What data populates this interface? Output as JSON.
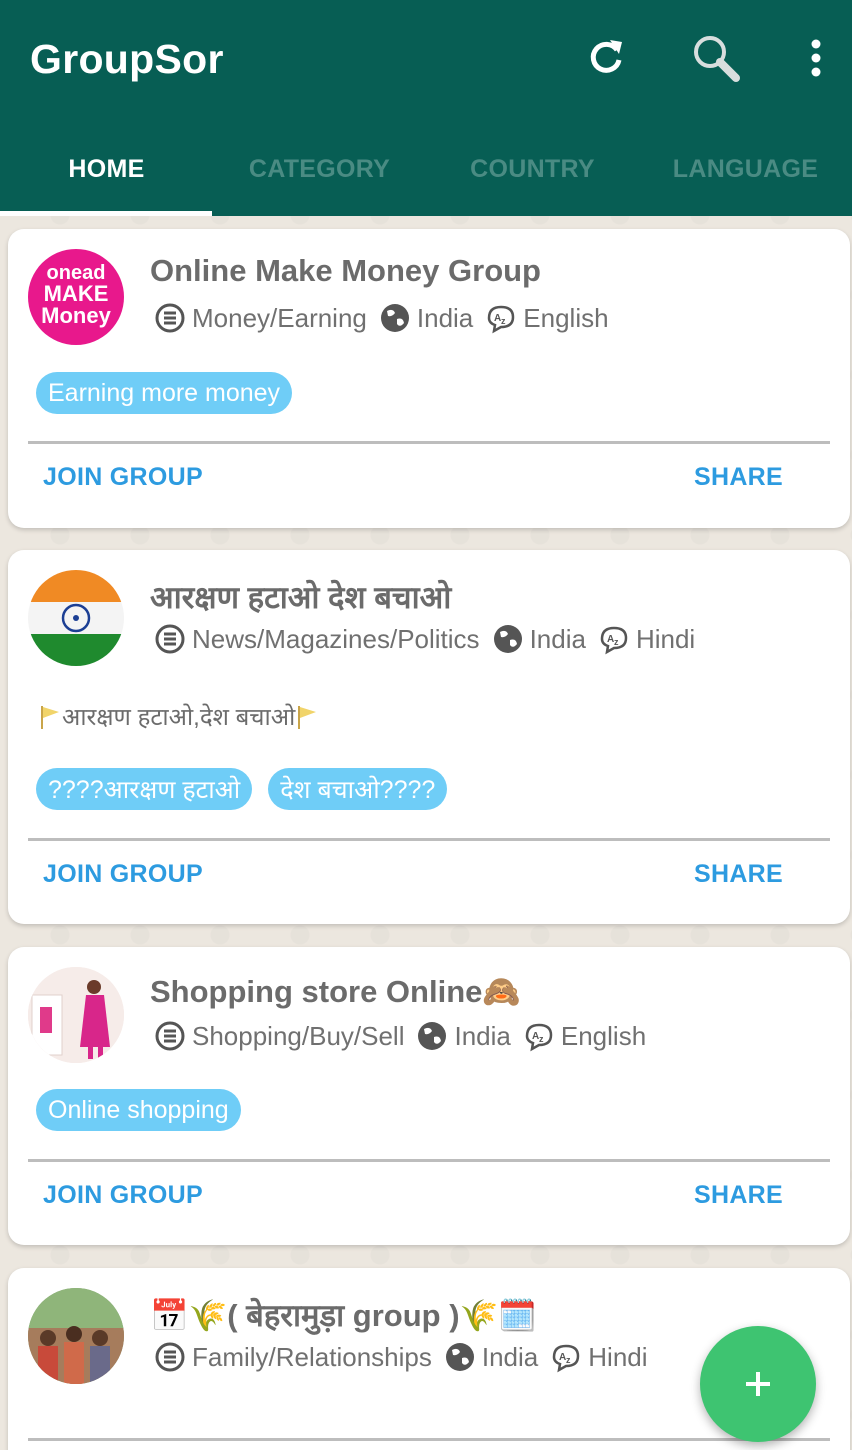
{
  "app": {
    "title": "GroupSor"
  },
  "toolbar": {
    "icons": [
      "refresh-icon",
      "search-icon",
      "more-vert-icon"
    ]
  },
  "tabs": [
    {
      "label": "HOME",
      "active": true
    },
    {
      "label": "CATEGORY",
      "active": false
    },
    {
      "label": "COUNTRY",
      "active": false
    },
    {
      "label": "LANGUAGE",
      "active": false
    }
  ],
  "colors": {
    "appbar": "#075e54",
    "chip": "#6fcdf7",
    "action": "#2d9be0",
    "fab": "#3ec471"
  },
  "cards": [
    {
      "title": "Online Make Money Group",
      "category": "Money/Earning",
      "country": "India",
      "language": "English",
      "description": "",
      "tags": [
        "Earning more money"
      ],
      "avatar_text": [
        "onead",
        "MAKE",
        "Money"
      ],
      "join_label": "JOIN GROUP",
      "share_label": "SHARE"
    },
    {
      "title": "आरक्षण हटाओ देश बचाओ",
      "category": "News/Magazines/Politics",
      "country": "India",
      "language": "Hindi",
      "description": "आरक्षण हटाओ,देश बचाओ",
      "tags": [
        "????आरक्षण हटाओ",
        "देश बचाओ????"
      ],
      "join_label": "JOIN GROUP",
      "share_label": "SHARE"
    },
    {
      "title": "Shopping store Online🙈",
      "category": "Shopping/Buy/Sell",
      "country": "India",
      "language": "English",
      "description": "",
      "tags": [
        "Online shopping"
      ],
      "join_label": "JOIN GROUP",
      "share_label": "SHARE"
    },
    {
      "title": "📅🌾( बेहरामुड़ा group )🌾🗓️",
      "category": "Family/Relationships",
      "country": "India",
      "language": "Hindi"
    }
  ],
  "fab": {
    "label": "+"
  }
}
